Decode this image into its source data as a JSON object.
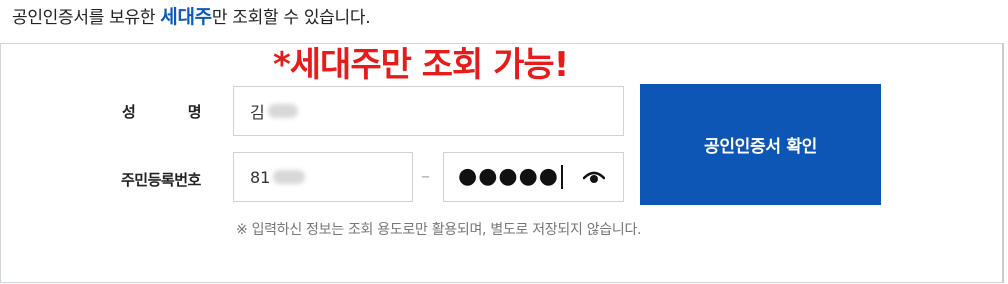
{
  "notice": {
    "prefix": "공인인증서를 보유한 ",
    "highlight": "세대주",
    "suffix": "만 조회할 수 있습니다."
  },
  "banner": "*세대주만 조회 가능!",
  "form": {
    "name_label": "성명",
    "name_value": "김",
    "rrn_label": "주민등록번호",
    "rrn_front_value": "81",
    "rrn_separator": "–",
    "rrn_back_masked": "●●●●●",
    "toggle_icon": "eye-icon",
    "submit_label": "공인인증서 확인",
    "disclaimer": "※ 입력하신 정보는 조회 용도로만 활용되며, 별도로 저장되지 않습니다."
  },
  "colors": {
    "accent": "#0d56b5",
    "highlight_text": "#0d5bb8",
    "banner_red": "#e81b1b"
  }
}
